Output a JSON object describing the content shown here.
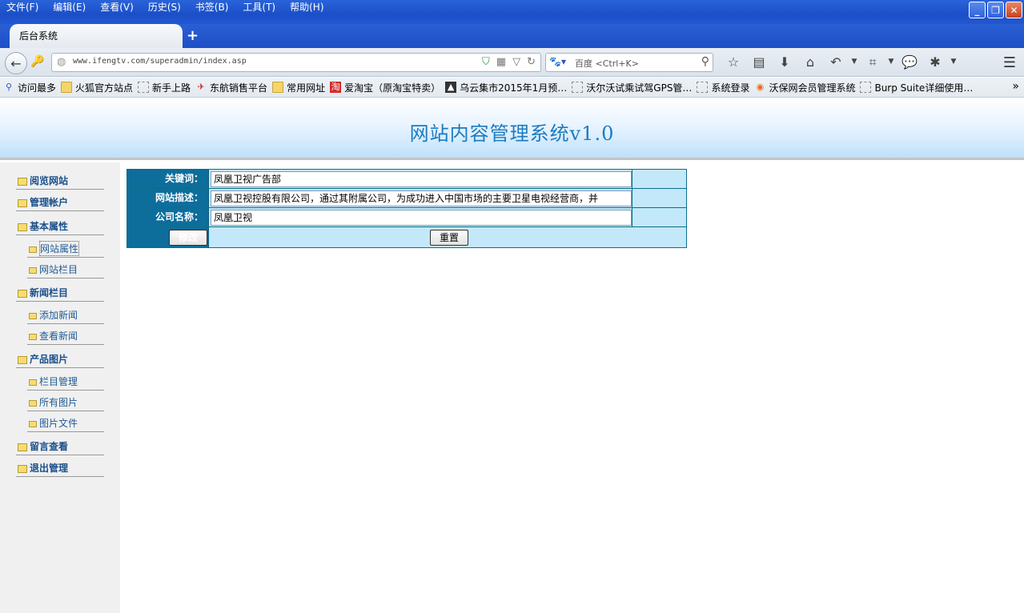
{
  "menu": [
    "文件(F)",
    "编辑(E)",
    "查看(V)",
    "历史(S)",
    "书签(B)",
    "工具(T)",
    "帮助(H)"
  ],
  "tab": {
    "title": "后台系统",
    "new_tab": "+"
  },
  "nav": {
    "url": "www.ifengtv.com/superadmin/index.asp",
    "search_engine": "百度",
    "search_placeholder": "<Ctrl+K>"
  },
  "bookmarks": [
    {
      "label": "访问最多",
      "icon": "blue"
    },
    {
      "label": "火狐官方站点",
      "icon": "folder"
    },
    {
      "label": "新手上路",
      "icon": "page"
    },
    {
      "label": "东航销售平台",
      "icon": "plane"
    },
    {
      "label": "常用网址",
      "icon": "folder"
    },
    {
      "label": "爱淘宝（原淘宝特卖）",
      "icon": "red"
    },
    {
      "label": "乌云集市2015年1月预…",
      "icon": "dark"
    },
    {
      "label": "沃尔沃试乘试驾GPS管…",
      "icon": "page"
    },
    {
      "label": "系统登录",
      "icon": "page"
    },
    {
      "label": "沃保网会员管理系统",
      "icon": "fire"
    },
    {
      "label": "Burp Suite详细使用…",
      "icon": "page"
    }
  ],
  "header": {
    "title": "网站内容管理系统v1.0"
  },
  "sidebar": {
    "items": [
      {
        "label": "阅览网站",
        "type": "main"
      },
      {
        "label": "管理帐户",
        "type": "main"
      },
      {
        "label": "基本属性",
        "type": "main"
      },
      {
        "label": "网站属性",
        "type": "sub",
        "active": true
      },
      {
        "label": "网站栏目",
        "type": "sub"
      },
      {
        "label": "新闻栏目",
        "type": "main"
      },
      {
        "label": "添加新闻",
        "type": "sub"
      },
      {
        "label": "查看新闻",
        "type": "sub"
      },
      {
        "label": "产品图片",
        "type": "main"
      },
      {
        "label": "栏目管理",
        "type": "sub"
      },
      {
        "label": "所有图片",
        "type": "sub"
      },
      {
        "label": "图片文件",
        "type": "sub"
      },
      {
        "label": "留言查看",
        "type": "main"
      },
      {
        "label": "退出管理",
        "type": "main"
      }
    ]
  },
  "form": {
    "keywords_label": "关键词：",
    "keywords_value": "凤凰卫视广告部",
    "description_label": "网站描述：",
    "description_value": "凤凰卫视控股有限公司，通过其附属公司，为成功进入中国市场的主要卫星电视经营商，并",
    "company_label": "公司名称：",
    "company_value": "凤凰卫视",
    "modify_button": "修改",
    "reset_button": "重置"
  }
}
